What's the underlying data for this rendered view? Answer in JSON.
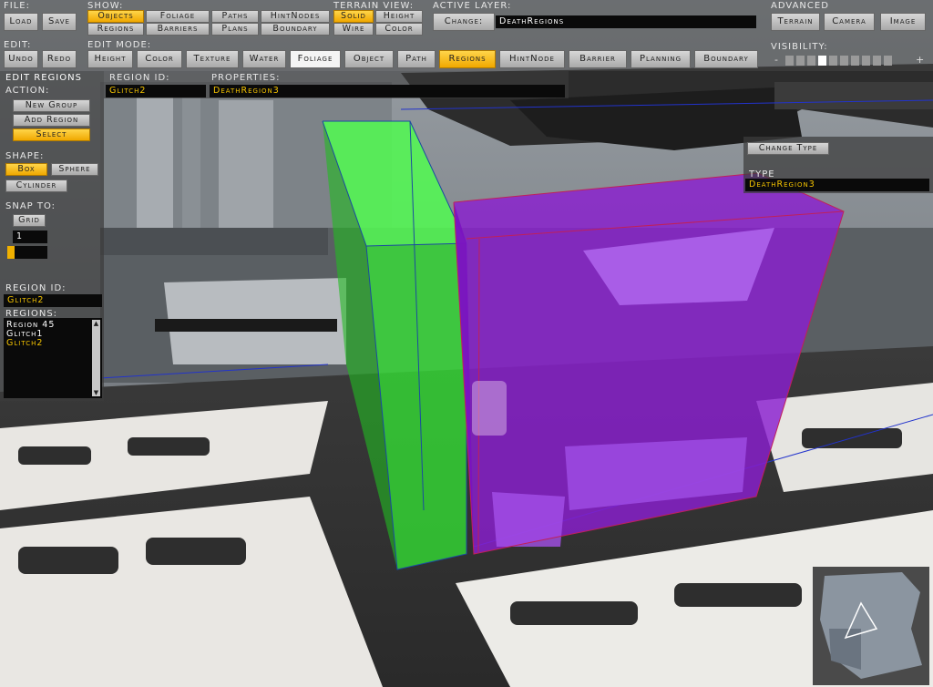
{
  "toolbar": {
    "file_label": "File:",
    "load": "Load",
    "save": "Save",
    "show_label": "Show:",
    "show_buttons": [
      "Objects",
      "Foliage",
      "Paths",
      "HintNodes",
      "Regions",
      "Barriers",
      "Plans",
      "Boundary"
    ],
    "terrain_view_label": "Terrain View:",
    "terrain_buttons": [
      "Solid",
      "Height",
      "Wire",
      "Color"
    ],
    "active_layer_label": "Active Layer:",
    "change_button": "Change:",
    "active_layer_value": "DeathRegions",
    "advanced_label": "Advanced",
    "advanced_buttons": [
      "Terrain",
      "Camera",
      "Image"
    ],
    "edit_label": "Edit:",
    "undo": "Undo",
    "redo": "Redo",
    "edit_mode_label": "Edit Mode:",
    "edit_modes": [
      "Height",
      "Color",
      "Texture",
      "Water",
      "Foliage",
      "Object",
      "Path",
      "Regions",
      "HintNode",
      "Barrier",
      "Planning",
      "Boundary"
    ],
    "visibility_label": "Visibility:",
    "visibility_minus": "-",
    "visibility_plus": "+"
  },
  "left_panel": {
    "title": "Edit Regions",
    "action_label": "Action:",
    "new_group": "New Group",
    "add_region": "Add Region",
    "select": "Select",
    "shape_label": "Shape:",
    "box": "Box",
    "sphere": "Sphere",
    "cylinder": "Cylinder",
    "snap_label": "Snap To:",
    "grid": "Grid",
    "snap_value": "1",
    "region_id_label": "Region ID:",
    "region_id_value": "Glitch2",
    "regions_label": "Regions:",
    "regions": [
      "Region 45",
      "Glitch1",
      "Glitch2"
    ]
  },
  "header_fields": {
    "region_id_label": "Region ID:",
    "region_id_value": "Glitch2",
    "properties_label": "Properties:",
    "properties_value": "DeathRegion3"
  },
  "right_panel": {
    "change_type": "Change Type",
    "type_label": "Type",
    "type_value": "DeathRegion3"
  },
  "colors": {
    "accent": "#f0b000",
    "green_region": "#33dd33",
    "purple_region": "#8a22cc"
  }
}
